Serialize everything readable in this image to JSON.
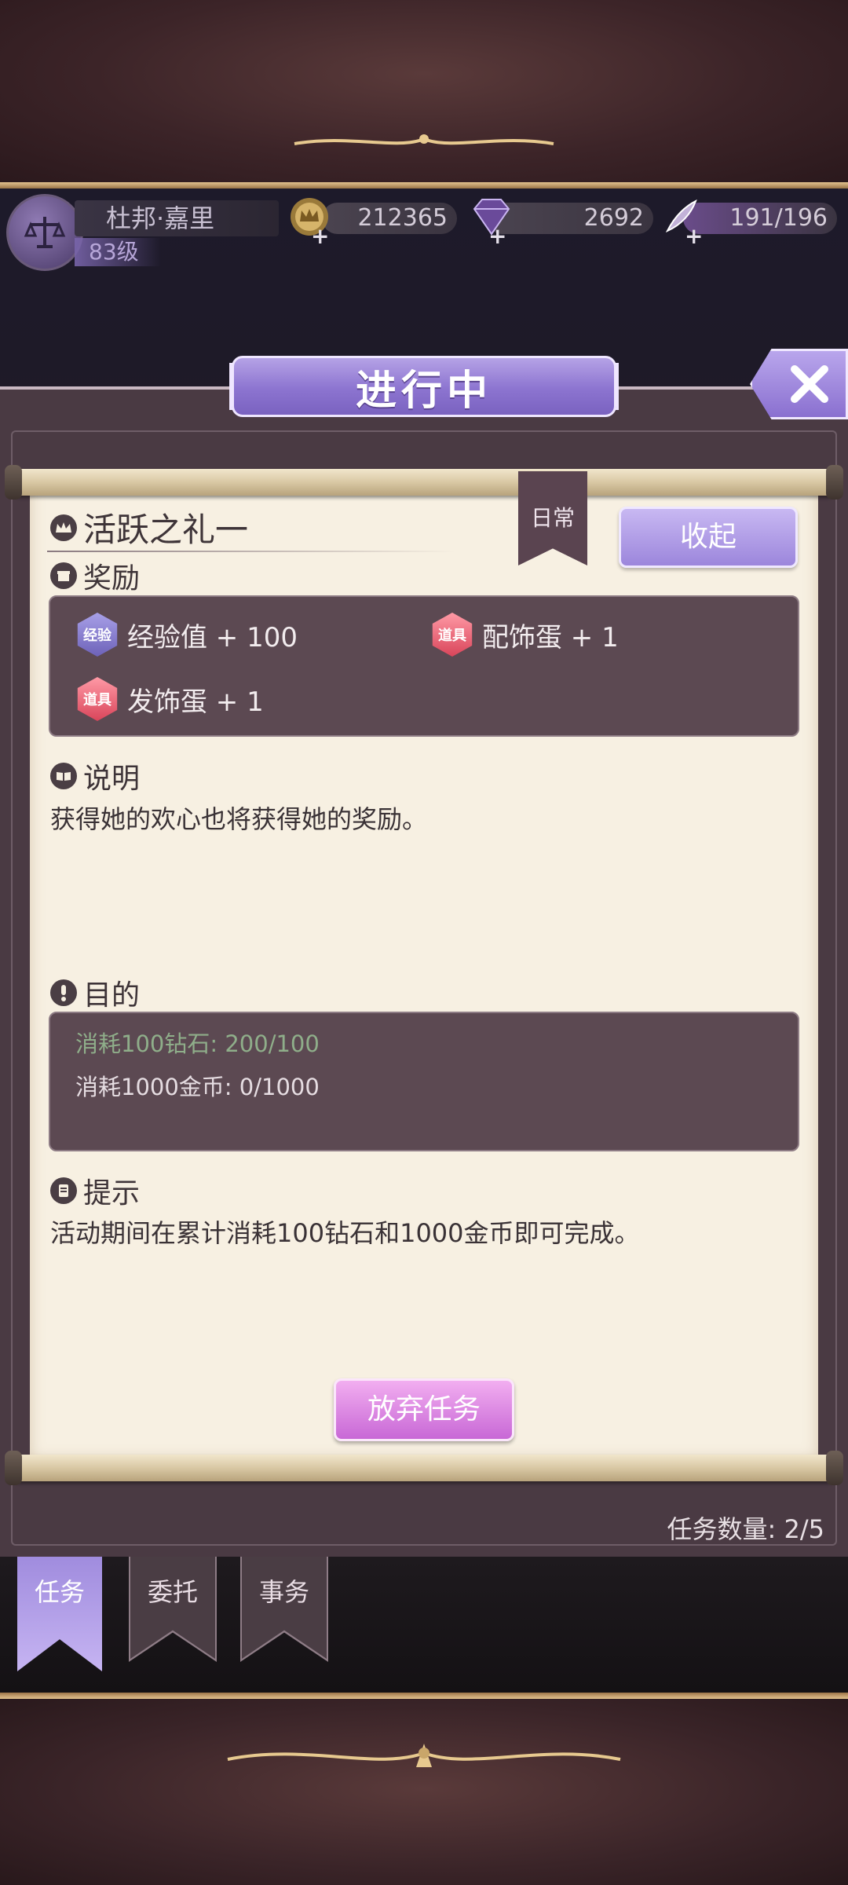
{
  "player": {
    "name": "杜邦·嘉里",
    "level": "83级"
  },
  "resources": {
    "gold": "212365",
    "diamonds": "2692",
    "stamina": "191/196"
  },
  "panel": {
    "title": "进行中",
    "close_icon": "close-x-icon"
  },
  "quest": {
    "name": "活跃之礼一",
    "tag": "日常",
    "collapse_label": "收起",
    "rewards_heading": "奖励",
    "rewards": [
      {
        "badge": "经验",
        "label": "经验值 + 100",
        "type": "exp"
      },
      {
        "badge": "道具",
        "label": "配饰蛋 + 1",
        "type": "item"
      },
      {
        "badge": "道具",
        "label": "发饰蛋 + 1",
        "type": "item"
      }
    ],
    "desc_heading": "说明",
    "description": "获得她的欢心也将获得她的奖励。",
    "goal_heading": "目的",
    "objectives": [
      {
        "text": "消耗100钻石: 200/100",
        "done": true
      },
      {
        "text": "消耗1000金币: 0/1000",
        "done": false
      }
    ],
    "hint_heading": "提示",
    "hint": "活动期间在累计消耗100钻石和1000金币即可完成。",
    "abandon_label": "放弃任务"
  },
  "task_count": "任务数量: 2/5",
  "tabs": [
    {
      "label": "任务",
      "active": true
    },
    {
      "label": "委托",
      "active": false
    },
    {
      "label": "事务",
      "active": false
    }
  ],
  "colors": {
    "accent_purple": "#9c86dc",
    "done_green": "#8fae8a",
    "paper": "#f7f0e2",
    "dark_box": "#5c4952"
  }
}
